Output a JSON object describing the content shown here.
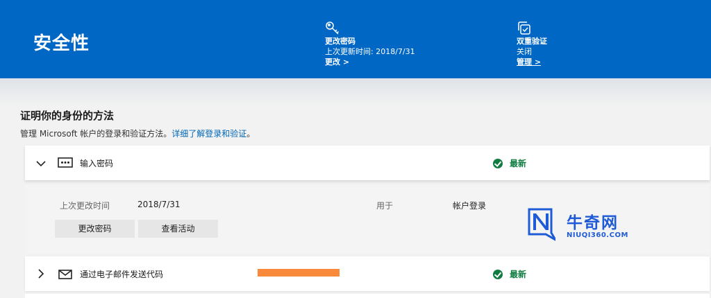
{
  "header": {
    "title": "安全性",
    "password": {
      "icon": "key-icon",
      "title": "更改密码",
      "detail": "上次更新时间: 2018/7/31",
      "link": "更改 >"
    },
    "two_step": {
      "icon": "shield-check-icon",
      "title": "双重验证",
      "detail": "关闭",
      "link": "管理 >"
    }
  },
  "section": {
    "title": "证明你的身份的方法",
    "desc": "管理 Microsoft 帐户的登录和验证方法。",
    "link": "详细了解登录和验证",
    "desc_end": "。"
  },
  "methods": [
    {
      "icon": "password-dots-icon",
      "label": "输入密码",
      "status": "最新",
      "expanded": true,
      "details": {
        "last_changed_label": "上次更改时间",
        "last_changed_value": "2018/7/31",
        "used_for_label": "用于",
        "used_for_value": "帐户登录",
        "buttons": [
          "更改密码",
          "查看活动"
        ]
      }
    },
    {
      "icon": "envelope-icon",
      "label": "通过电子邮件发送代码",
      "status": "最新",
      "expanded": false
    }
  ],
  "watermark": {
    "text": "牛奇网",
    "url": "NIUQI360.COM"
  },
  "colors": {
    "header_bg": "#0067c5",
    "status_green": "#107c41",
    "link_blue": "#0067b8",
    "redaction": "#f98a3b"
  }
}
